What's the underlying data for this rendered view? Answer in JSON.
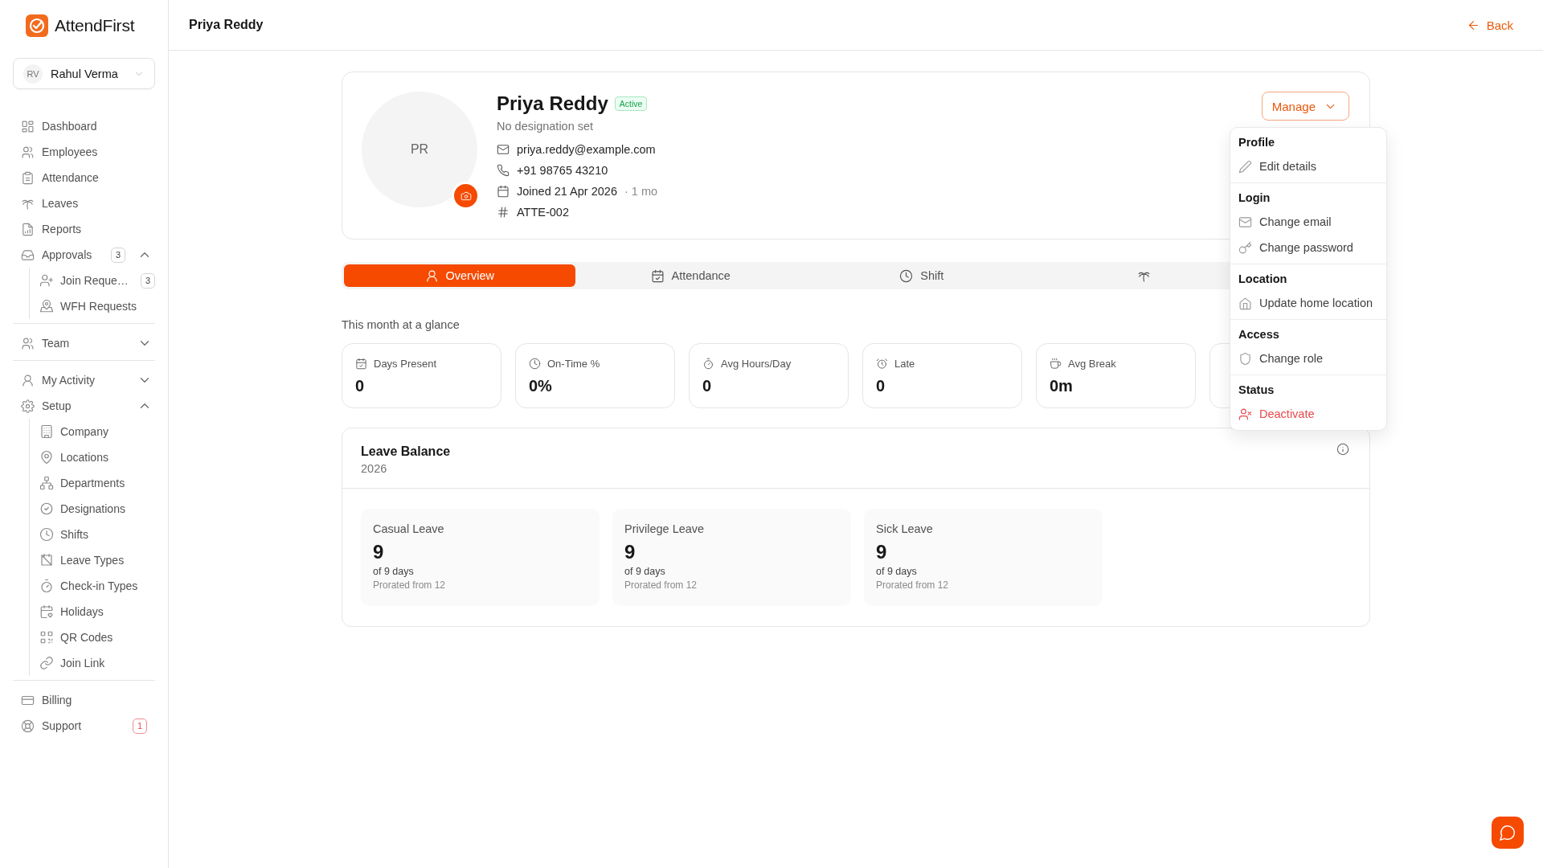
{
  "sidebar": {
    "brand": "AttendFirst",
    "user": {
      "initials": "RV",
      "name": "Rahul Verma"
    },
    "groups": [
      [
        {
          "label": "Dashboard"
        },
        {
          "label": "Employees"
        },
        {
          "label": "Attendance"
        },
        {
          "label": "Leaves"
        },
        {
          "label": "Reports"
        },
        {
          "label": "Approvals",
          "badge": {
            "text": "3",
            "alert": false
          },
          "expanded": true,
          "children": [
            {
              "label": "Join Reque…",
              "badge": {
                "text": "3",
                "alert": false
              }
            },
            {
              "label": "WFH Requests"
            }
          ]
        }
      ],
      [
        {
          "label": "Team",
          "expanded": false
        }
      ],
      [
        {
          "label": "My Activity",
          "expanded": false
        },
        {
          "label": "Setup",
          "expanded": true,
          "children": [
            {
              "label": "Company"
            },
            {
              "label": "Locations"
            },
            {
              "label": "Departments"
            },
            {
              "label": "Designations"
            },
            {
              "label": "Shifts"
            },
            {
              "label": "Leave Types"
            },
            {
              "label": "Check-in Types"
            },
            {
              "label": "Holidays"
            },
            {
              "label": "QR Codes"
            },
            {
              "label": "Join Link"
            }
          ]
        }
      ],
      [
        {
          "label": "Billing"
        },
        {
          "label": "Support",
          "badge": {
            "text": "1",
            "alert": true
          }
        }
      ]
    ]
  },
  "header": {
    "title": "Priya Reddy",
    "back": "Back"
  },
  "profile": {
    "initials": "PR",
    "name": "Priya Reddy",
    "status": "Active",
    "designation": "No designation set",
    "email": "priya.reddy@example.com",
    "phone": "+91 98765 43210",
    "joined": "Joined 21 Apr 2026",
    "tenure": "· 1 mo",
    "employee_id": "ATTE-002",
    "manage": {
      "label": "Manage",
      "open": true,
      "sections": [
        {
          "title": "Profile",
          "items": [
            {
              "label": "Edit details",
              "kind": "normal"
            }
          ]
        },
        {
          "title": "Login",
          "items": [
            {
              "label": "Change email",
              "kind": "normal"
            },
            {
              "label": "Change password",
              "kind": "normal"
            }
          ]
        },
        {
          "title": "Location",
          "items": [
            {
              "label": "Update home location",
              "kind": "normal"
            }
          ]
        },
        {
          "title": "Access",
          "items": [
            {
              "label": "Change role",
              "kind": "normal"
            }
          ]
        },
        {
          "title": "Status",
          "items": [
            {
              "label": "Deactivate",
              "kind": "danger"
            }
          ]
        }
      ]
    }
  },
  "tabs": [
    {
      "label": "Overview",
      "selected": true
    },
    {
      "label": "Attendance",
      "selected": false
    },
    {
      "label": "Shift",
      "selected": false
    },
    {
      "selected": false
    }
  ],
  "glance": {
    "title": "This month at a glance",
    "stats": [
      {
        "label": "Days Present",
        "value": "0"
      },
      {
        "label": "On-Time %",
        "value": "0%"
      },
      {
        "label": "Avg Hours/Day",
        "value": "0"
      },
      {
        "label": "Late",
        "value": "0"
      },
      {
        "label": "Avg Break",
        "value": "0m"
      }
    ]
  },
  "leave_balance": {
    "title": "Leave Balance",
    "year": "2026",
    "types": [
      {
        "name": "Casual Leave",
        "balance": "9",
        "total": "of 9 days",
        "note": "Prorated from 12"
      },
      {
        "name": "Privilege Leave",
        "balance": "9",
        "total": "of 9 days",
        "note": "Prorated from 12"
      },
      {
        "name": "Sick Leave",
        "balance": "9",
        "total": "of 9 days",
        "note": "Prorated from 12"
      }
    ]
  }
}
